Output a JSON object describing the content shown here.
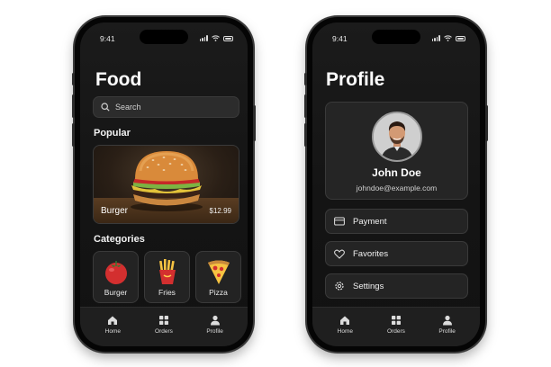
{
  "left_phone": {
    "status": {
      "time": "9:41"
    },
    "title": "Food",
    "search": {
      "placeholder": "Search"
    },
    "popular": {
      "heading": "Popular",
      "item": {
        "name": "Burger",
        "price": "$12.99"
      }
    },
    "categories": {
      "heading": "Categories",
      "items": [
        {
          "label": "Burger",
          "icon": "tomato-icon"
        },
        {
          "label": "Fries",
          "icon": "fries-icon"
        },
        {
          "label": "Pizza",
          "icon": "pizza-icon"
        }
      ]
    },
    "tabbar": {
      "items": [
        {
          "label": "Home",
          "icon": "home-icon"
        },
        {
          "label": "Orders",
          "icon": "grid-icon"
        },
        {
          "label": "Profile",
          "icon": "person-icon"
        }
      ]
    }
  },
  "right_phone": {
    "status": {
      "time": "9:41"
    },
    "title": "Profile",
    "profile": {
      "name": "John Doe",
      "email": "johndoe@example.com"
    },
    "menu": {
      "items": [
        {
          "label": "Payment",
          "icon": "card-icon"
        },
        {
          "label": "Favorites",
          "icon": "heart-icon"
        },
        {
          "label": "Settings",
          "icon": "gear-icon"
        }
      ]
    },
    "tabbar": {
      "items": [
        {
          "label": "Home",
          "icon": "home-icon"
        },
        {
          "label": "Orders",
          "icon": "grid-icon"
        },
        {
          "label": "Profile",
          "icon": "person-icon"
        }
      ]
    }
  },
  "colors": {
    "background": "#ffffff",
    "screen": "#161616",
    "card": "#252525",
    "text": "#f2f2f2"
  }
}
